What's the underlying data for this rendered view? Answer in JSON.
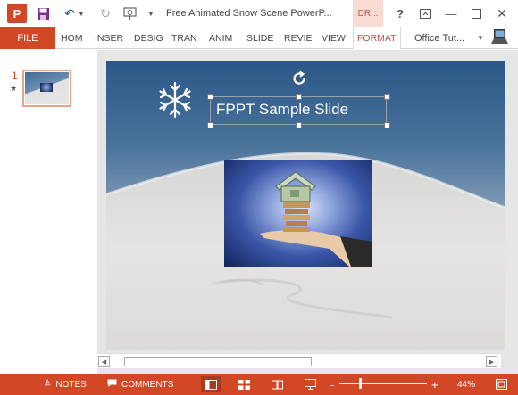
{
  "app": {
    "window_title": "Free Animated Snow Scene PowerP...",
    "context_tab": "DR..."
  },
  "window_controls": {
    "help": "?",
    "minimize": "—",
    "close": "✕"
  },
  "ribbon": {
    "file_label": "FILE",
    "tabs": [
      "HOM",
      "INSER",
      "DESIG",
      "TRAN",
      "ANIM",
      "SLIDE",
      "REVIE",
      "VIEW",
      "FORMAT"
    ],
    "selected_tab": "FORMAT",
    "account_name": "Office Tut..."
  },
  "slide_pane": {
    "slides": [
      {
        "number": "1",
        "has_animation": true
      }
    ]
  },
  "slide": {
    "title": "FPPT Sample Slide"
  },
  "status": {
    "notes_label": "NOTES",
    "comments_label": "COMMENTS",
    "zoom_minus": "-",
    "zoom_plus": "+",
    "zoom_level": "44%"
  },
  "colors": {
    "accent": "#d24726",
    "context_tab_bg": "#f8dcd3",
    "context_tab_text": "#c0504d",
    "sky_top": "#2b5787",
    "picture_center": "#dfe8ff",
    "picture_edge": "#13245c"
  },
  "icons": {
    "app": "powerpoint-logo-icon",
    "save": "save-icon",
    "undo": "undo-icon",
    "redo": "redo-icon",
    "present": "present-from-beginning-icon",
    "rotate": "rotate-handle-icon",
    "snowflake": "snowflake-icon"
  }
}
